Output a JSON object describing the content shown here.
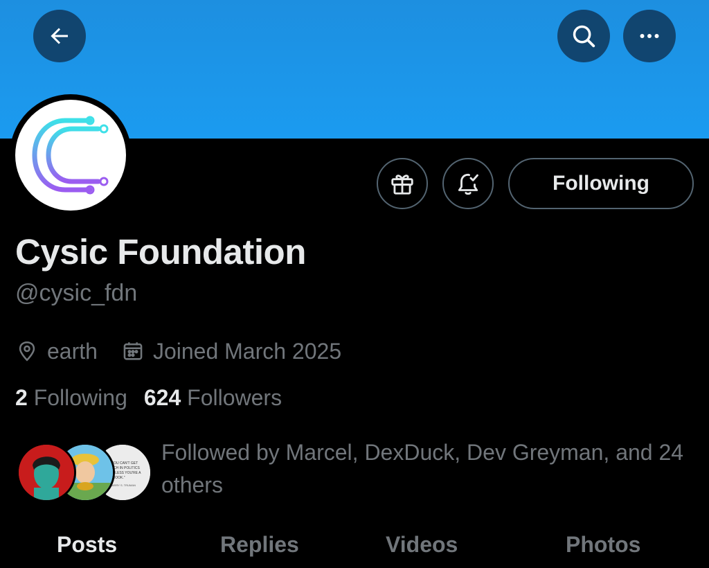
{
  "header": {
    "back_icon": "arrow-left-icon",
    "search_icon": "search-icon",
    "more_icon": "more-horizontal-icon",
    "banner_color": "#1b9bf0"
  },
  "profile": {
    "display_name": "Cysic Foundation",
    "handle": "@cysic_fdn",
    "location": "earth",
    "joined": "Joined March 2025",
    "following_count": "2",
    "following_label": "Following",
    "followers_count": "624",
    "followers_label": "Followers",
    "followed_by": "Followed by Marcel, DexDuck, Dev Greyman, and 24 others",
    "avatar_logo": "cysic-logo",
    "logo_colors": [
      "#3ee0e8",
      "#9b5cf0"
    ]
  },
  "actions": {
    "gift_icon": "gift-icon",
    "notify_icon": "bell-check-icon",
    "following_button": "Following"
  },
  "followed_avatars": [
    {
      "name": "Marcel"
    },
    {
      "name": "DexDuck"
    },
    {
      "name": "Dev Greyman",
      "quote": "\"YOU CAN'T GET RICH IN POLITICS UNLESS YOU'RE A CROOK.\" HARRY S. TRUMAN"
    }
  ],
  "tabs": [
    "Posts",
    "Replies",
    "Videos",
    "Photos"
  ]
}
